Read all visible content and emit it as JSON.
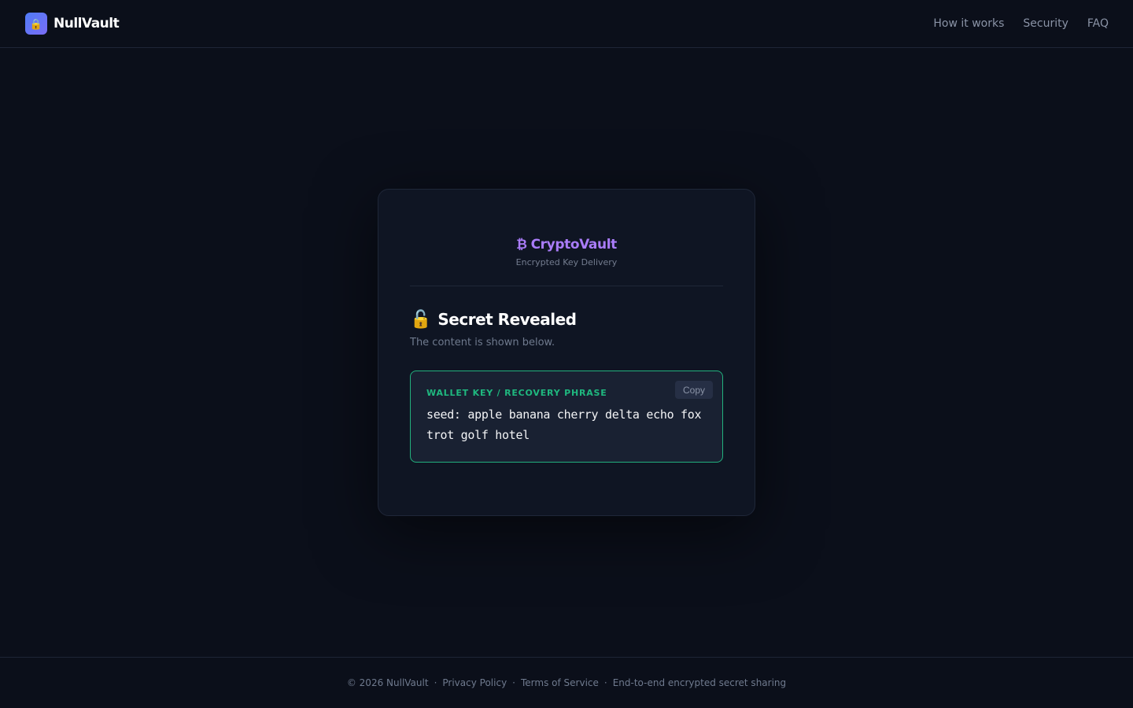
{
  "header": {
    "brand_icon": "lock-icon",
    "brand_name": "NullVault",
    "nav": [
      {
        "label": "How it works"
      },
      {
        "label": "Security"
      },
      {
        "label": "FAQ"
      }
    ]
  },
  "card": {
    "vault_icon": "bitcoin-icon",
    "vault_symbol": "₿",
    "vault_name": "CryptoVault",
    "vault_subtitle": "Encrypted Key Delivery",
    "reveal_icon": "open-lock-icon",
    "reveal_emoji": "🔓",
    "reveal_title": "Secret Revealed",
    "reveal_desc": "The content is shown below.",
    "secret": {
      "label": "WALLET KEY / RECOVERY PHRASE",
      "copy_label": "Copy",
      "value": "seed: apple banana cherry delta echo fox trot golf hotel"
    }
  },
  "footer": {
    "copyright": "© 2026 NullVault",
    "separator": "·",
    "privacy": "Privacy Policy",
    "terms": "Terms of Service",
    "tagline": "End-to-end encrypted secret sharing"
  },
  "colors": {
    "background": "#0b0f1a",
    "accent_purple": "#a97cf8",
    "success_green": "#1fb87f"
  }
}
